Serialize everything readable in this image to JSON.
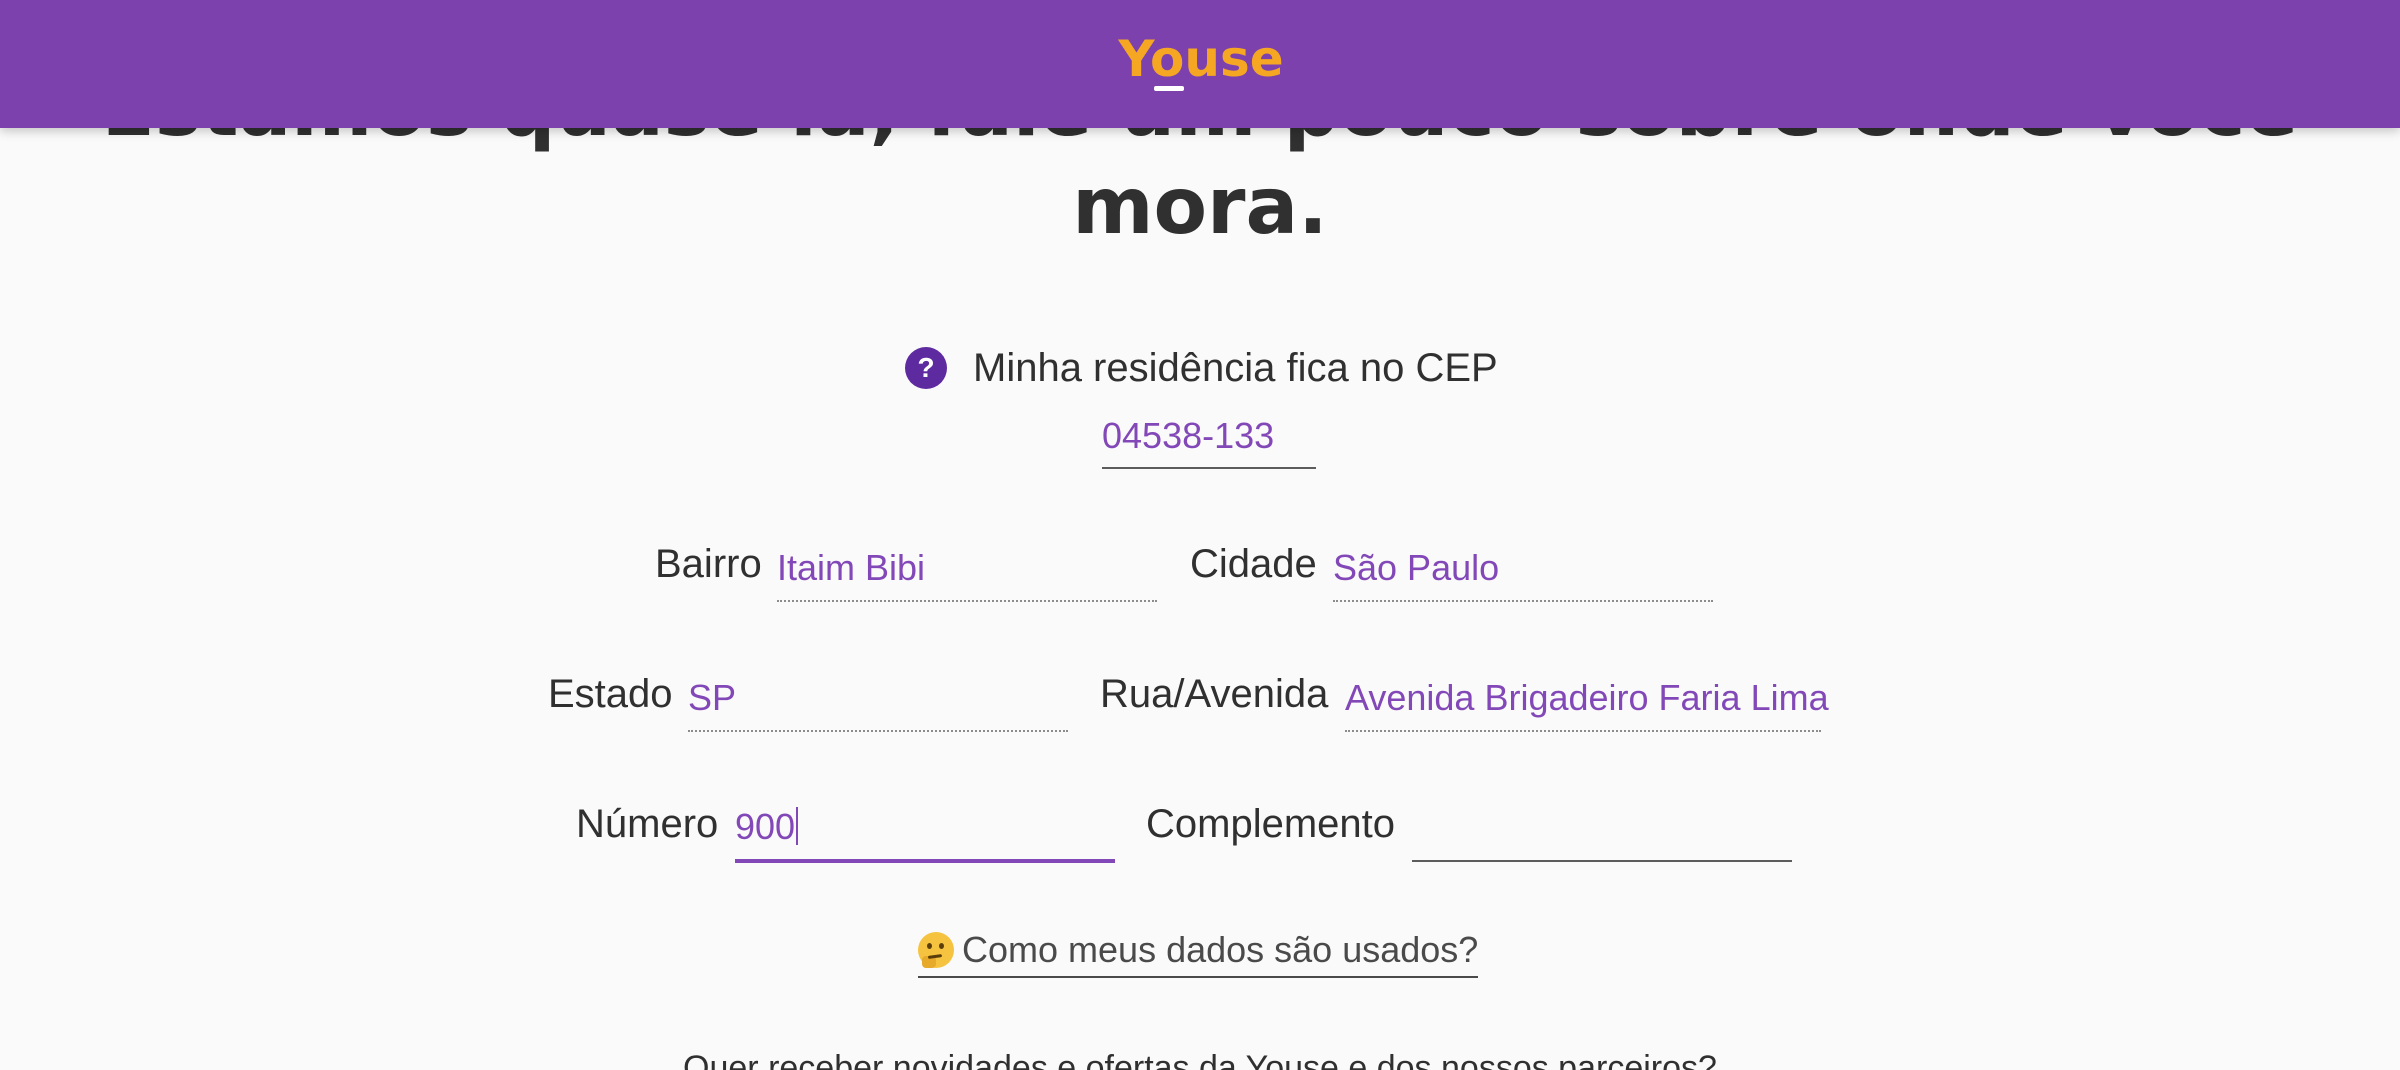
{
  "header": {
    "logo_text": "Youse",
    "brand_color": "#7c41ad",
    "logo_color": "#f5a623"
  },
  "title": {
    "line1": "Estamos quase lá, fale um pouco sobre onde você",
    "line2": "mora."
  },
  "cep": {
    "help_icon": "question-circle-icon",
    "help_icon_text": "?",
    "label": "Minha residência fica no CEP",
    "value": "04538-133"
  },
  "address": {
    "bairro": {
      "label": "Bairro",
      "value": "Itaim Bibi"
    },
    "cidade": {
      "label": "Cidade",
      "value": "São Paulo"
    },
    "estado": {
      "label": "Estado",
      "value": "SP"
    },
    "rua": {
      "label": "Rua/Avenida",
      "value": "Avenida Brigadeiro Faria Lima"
    },
    "numero": {
      "label": "Número",
      "value": "900"
    },
    "complemento": {
      "label": "Complemento",
      "value": ""
    }
  },
  "info_link": {
    "icon": "thinking-face-icon",
    "text": "Como meus dados são usados?"
  },
  "newsletter": {
    "question": "Quer receber novidades e ofertas da Youse e dos nossos parceiros?"
  },
  "colors": {
    "accent": "#8348b8",
    "text": "#303030"
  }
}
